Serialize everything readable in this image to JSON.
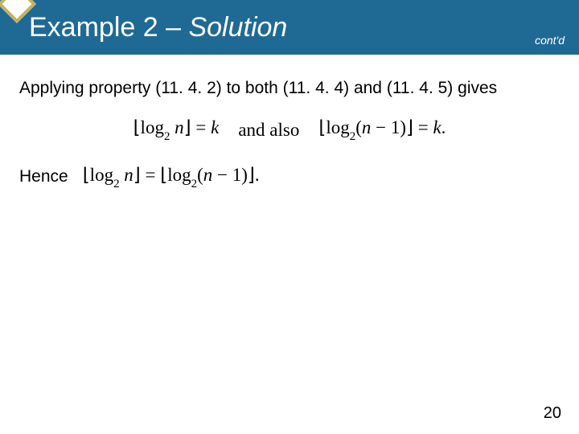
{
  "header": {
    "title_plain": "Example 2 – ",
    "title_italic": "Solution",
    "contd": "cont'd"
  },
  "body": {
    "line1": "Applying property (11. 4. 2) to both (11. 4. 4) and (11. 4. 5) gives",
    "hence": "Hence"
  },
  "formulas": {
    "eq1": "⌊log₂ n⌋ = k",
    "joiner": "and also",
    "eq2": "⌊log₂(n − 1)⌋ = k.",
    "eq3": "⌊log₂ n⌋ = ⌊log₂(n − 1)⌋."
  },
  "page_number": "20"
}
